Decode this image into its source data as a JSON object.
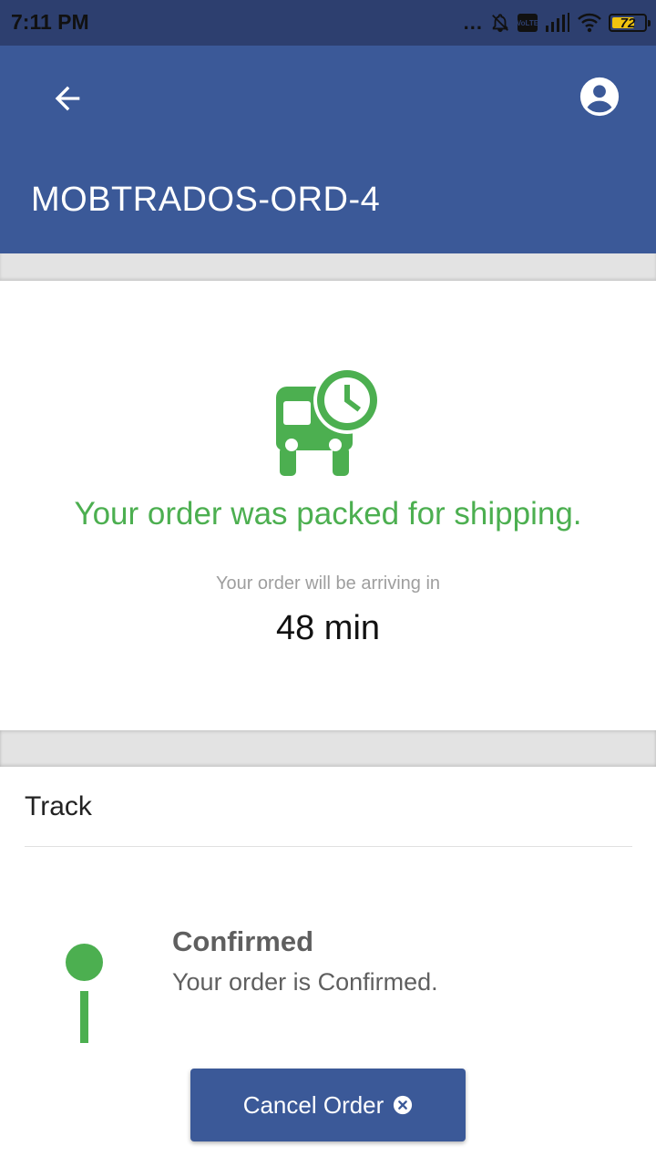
{
  "status_bar": {
    "time": "7:11 PM",
    "dots": "...",
    "volte_label": "VoLTE",
    "battery_level": "72",
    "battery_fraction": 0.72,
    "battery_color": "#f1c40f"
  },
  "app_bar": {
    "title": "MOBTRADOS-ORD-4",
    "back_icon": "arrow-left-icon",
    "profile_icon": "account-circle-icon",
    "color": "#3b5998"
  },
  "order_status": {
    "icon": "bus-clock-icon",
    "message": "Your order was packed for shipping.",
    "eta_label": "Your order will be arriving in",
    "eta_value": "48 min",
    "accent_color": "#4caf50"
  },
  "track": {
    "title": "Track",
    "steps": [
      {
        "title": "Confirmed",
        "description": "Your order is Confirmed."
      }
    ]
  },
  "actions": {
    "cancel_label": "Cancel Order",
    "cancel_icon": "close-circle-icon"
  }
}
